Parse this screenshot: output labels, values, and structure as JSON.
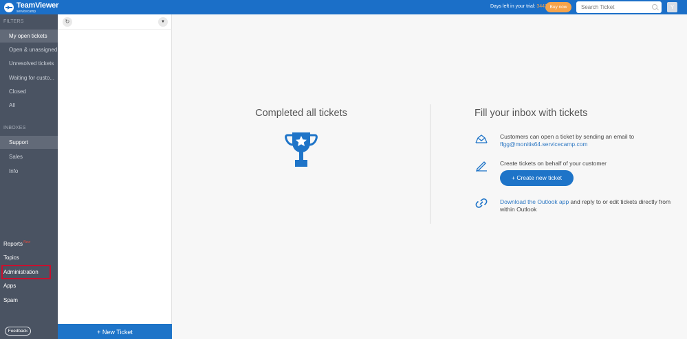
{
  "header": {
    "logo_title": "TeamViewer",
    "logo_subtitle": "servicecamp",
    "trial_label": "Days left in your trial:",
    "trial_days": "3441",
    "buy_label": "Buy now",
    "search_placeholder": "Search Ticket",
    "avatar_initial": "Y",
    "colors": {
      "bar": "#1b6fc8",
      "accent": "#f5a34a"
    }
  },
  "sidebar": {
    "filters_label": "FILTERS",
    "filters": [
      {
        "label": "My open tickets",
        "active": true
      },
      {
        "label": "Open & unassigned",
        "active": false
      },
      {
        "label": "Unresolved tickets",
        "active": false
      },
      {
        "label": "Waiting for custo...",
        "active": false
      },
      {
        "label": "Closed",
        "active": false
      },
      {
        "label": "All",
        "active": false
      }
    ],
    "inboxes_label": "INBOXES",
    "inboxes": [
      {
        "label": "Support",
        "active": true
      },
      {
        "label": "Sales",
        "active": false
      },
      {
        "label": "Info",
        "active": false
      }
    ],
    "bottom": {
      "reports": "Reports",
      "reports_badge": "New",
      "topics": "Topics",
      "administration": "Administration",
      "apps": "Apps",
      "spam": "Spam"
    },
    "feedback_label": "Feedback"
  },
  "list_panel": {
    "refresh_icon": "refresh-icon",
    "dropdown_icon": "chevron-down-icon",
    "new_ticket_label": "+ New Ticket"
  },
  "main": {
    "completed_title": "Completed all tickets",
    "trophy_icon": "trophy-icon",
    "fill_title": "Fill your inbox with tickets",
    "email_text": "Customers can open a ticket by sending an email to",
    "email_address": "ffgg@monitis64.servicecamp.com",
    "behalf_text": "Create tickets on behalf of your customer",
    "create_button": "Create new ticket",
    "outlook_link": "Download the Outlook app",
    "outlook_text_1": " and reply to or edit tickets directly from",
    "outlook_text_2": "within Outlook"
  }
}
